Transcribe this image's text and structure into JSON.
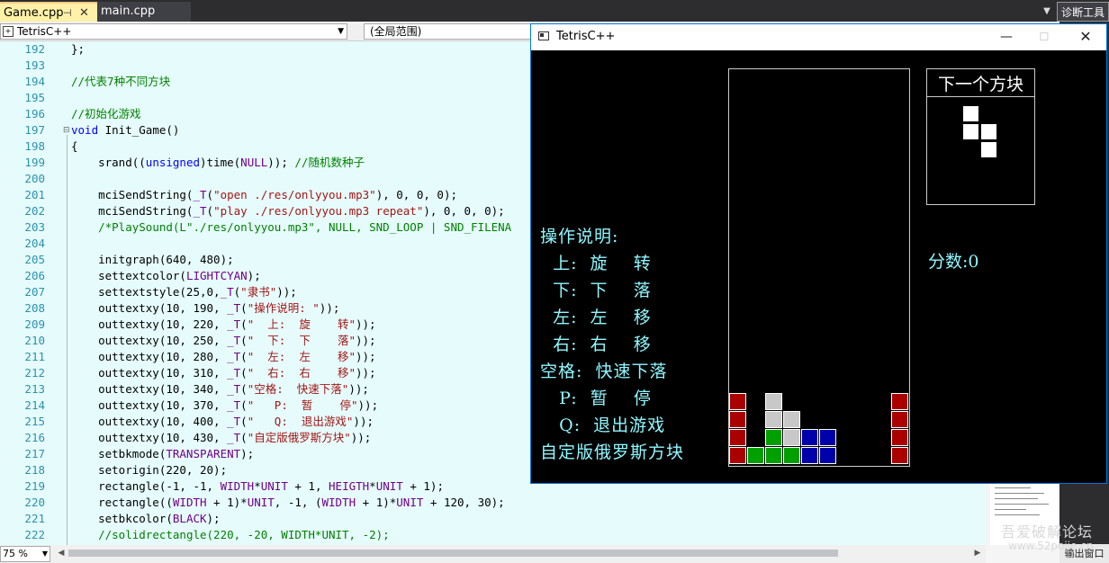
{
  "tabs": [
    {
      "label": "Game.cpp",
      "active": true
    },
    {
      "label": "main.cpp",
      "active": false
    }
  ],
  "right_tool": "诊断工具",
  "nav": {
    "project": "TetrisC++",
    "scope": "(全局范围)"
  },
  "editor": {
    "zoom": "75 %",
    "lines": [
      {
        "n": "192",
        "text": "};"
      },
      {
        "n": "193",
        "text": ""
      },
      {
        "n": "194",
        "text": "//代表7种不同方块"
      },
      {
        "n": "195",
        "text": ""
      },
      {
        "n": "196",
        "text": "//初始化游戏"
      },
      {
        "n": "197",
        "text": "void Init_Game()"
      },
      {
        "n": "198",
        "text": "{"
      },
      {
        "n": "199",
        "text": "    srand((unsigned)time(NULL)); //随机数种子"
      },
      {
        "n": "200",
        "text": ""
      },
      {
        "n": "201",
        "text": "    mciSendString(_T(\"open ./res/onlyyou.mp3\"), 0, 0, 0);"
      },
      {
        "n": "202",
        "text": "    mciSendString(_T(\"play ./res/onlyyou.mp3 repeat\"), 0, 0, 0);"
      },
      {
        "n": "203",
        "text": "    /*PlaySound(L\"./res/onlyyou.mp3\", NULL, SND_LOOP | SND_FILENA"
      },
      {
        "n": "204",
        "text": ""
      },
      {
        "n": "205",
        "text": "    initgraph(640, 480);"
      },
      {
        "n": "206",
        "text": "    settextcolor(LIGHTCYAN);"
      },
      {
        "n": "207",
        "text": "    settextstyle(25,0,_T(\"隶书\"));"
      },
      {
        "n": "208",
        "text": "    outtextxy(10, 190, _T(\"操作说明: \"));"
      },
      {
        "n": "209",
        "text": "    outtextxy(10, 220, _T(\"  上:  旋    转\"));"
      },
      {
        "n": "210",
        "text": "    outtextxy(10, 250, _T(\"  下:  下    落\"));"
      },
      {
        "n": "211",
        "text": "    outtextxy(10, 280, _T(\"  左:  左    移\"));"
      },
      {
        "n": "212",
        "text": "    outtextxy(10, 310, _T(\"  右:  右    移\"));"
      },
      {
        "n": "213",
        "text": "    outtextxy(10, 340, _T(\"空格:  快速下落\"));"
      },
      {
        "n": "214",
        "text": "    outtextxy(10, 370, _T(\"   P:  暂    停\"));"
      },
      {
        "n": "215",
        "text": "    outtextxy(10, 400, _T(\"   Q:  退出游戏\"));"
      },
      {
        "n": "216",
        "text": "    outtextxy(10, 430, _T(\"自定版俄罗斯方块\"));"
      },
      {
        "n": "217",
        "text": "    setbkmode(TRANSPARENT);"
      },
      {
        "n": "218",
        "text": "    setorigin(220, 20);"
      },
      {
        "n": "219",
        "text": "    rectangle(-1, -1, WIDTH*UNIT + 1, HEIGTH*UNIT + 1);"
      },
      {
        "n": "220",
        "text": "    rectangle((WIDTH + 1)*UNIT, -1, (WIDTH + 1)*UNIT + 120, 30);"
      },
      {
        "n": "221",
        "text": "    setbkcolor(BLACK);"
      },
      {
        "n": "222",
        "text": "    //solidrectangle(220, -20, WIDTH*UNIT, -2);"
      }
    ]
  },
  "game_window": {
    "title": "TetrisC++",
    "next_label": "下一个方块",
    "score_label": "分数:0",
    "instructions": [
      "操作说明:",
      "  上:  旋    转",
      "  下:  下    落",
      "  左:  左    移",
      "  右:  右    移",
      "空格:  快速下落",
      "   P:  暂    停",
      "   Q:  退出游戏",
      "自定版俄罗斯方块"
    ]
  },
  "watermark": {
    "line1": "吾爱破解论坛",
    "line2": "www.52pojie.cn"
  },
  "output_tab": "输出窗口",
  "colors": {
    "red": "#aa0000",
    "green": "#00a000",
    "blue": "#0000aa",
    "cyan": "#8ff8ff"
  }
}
